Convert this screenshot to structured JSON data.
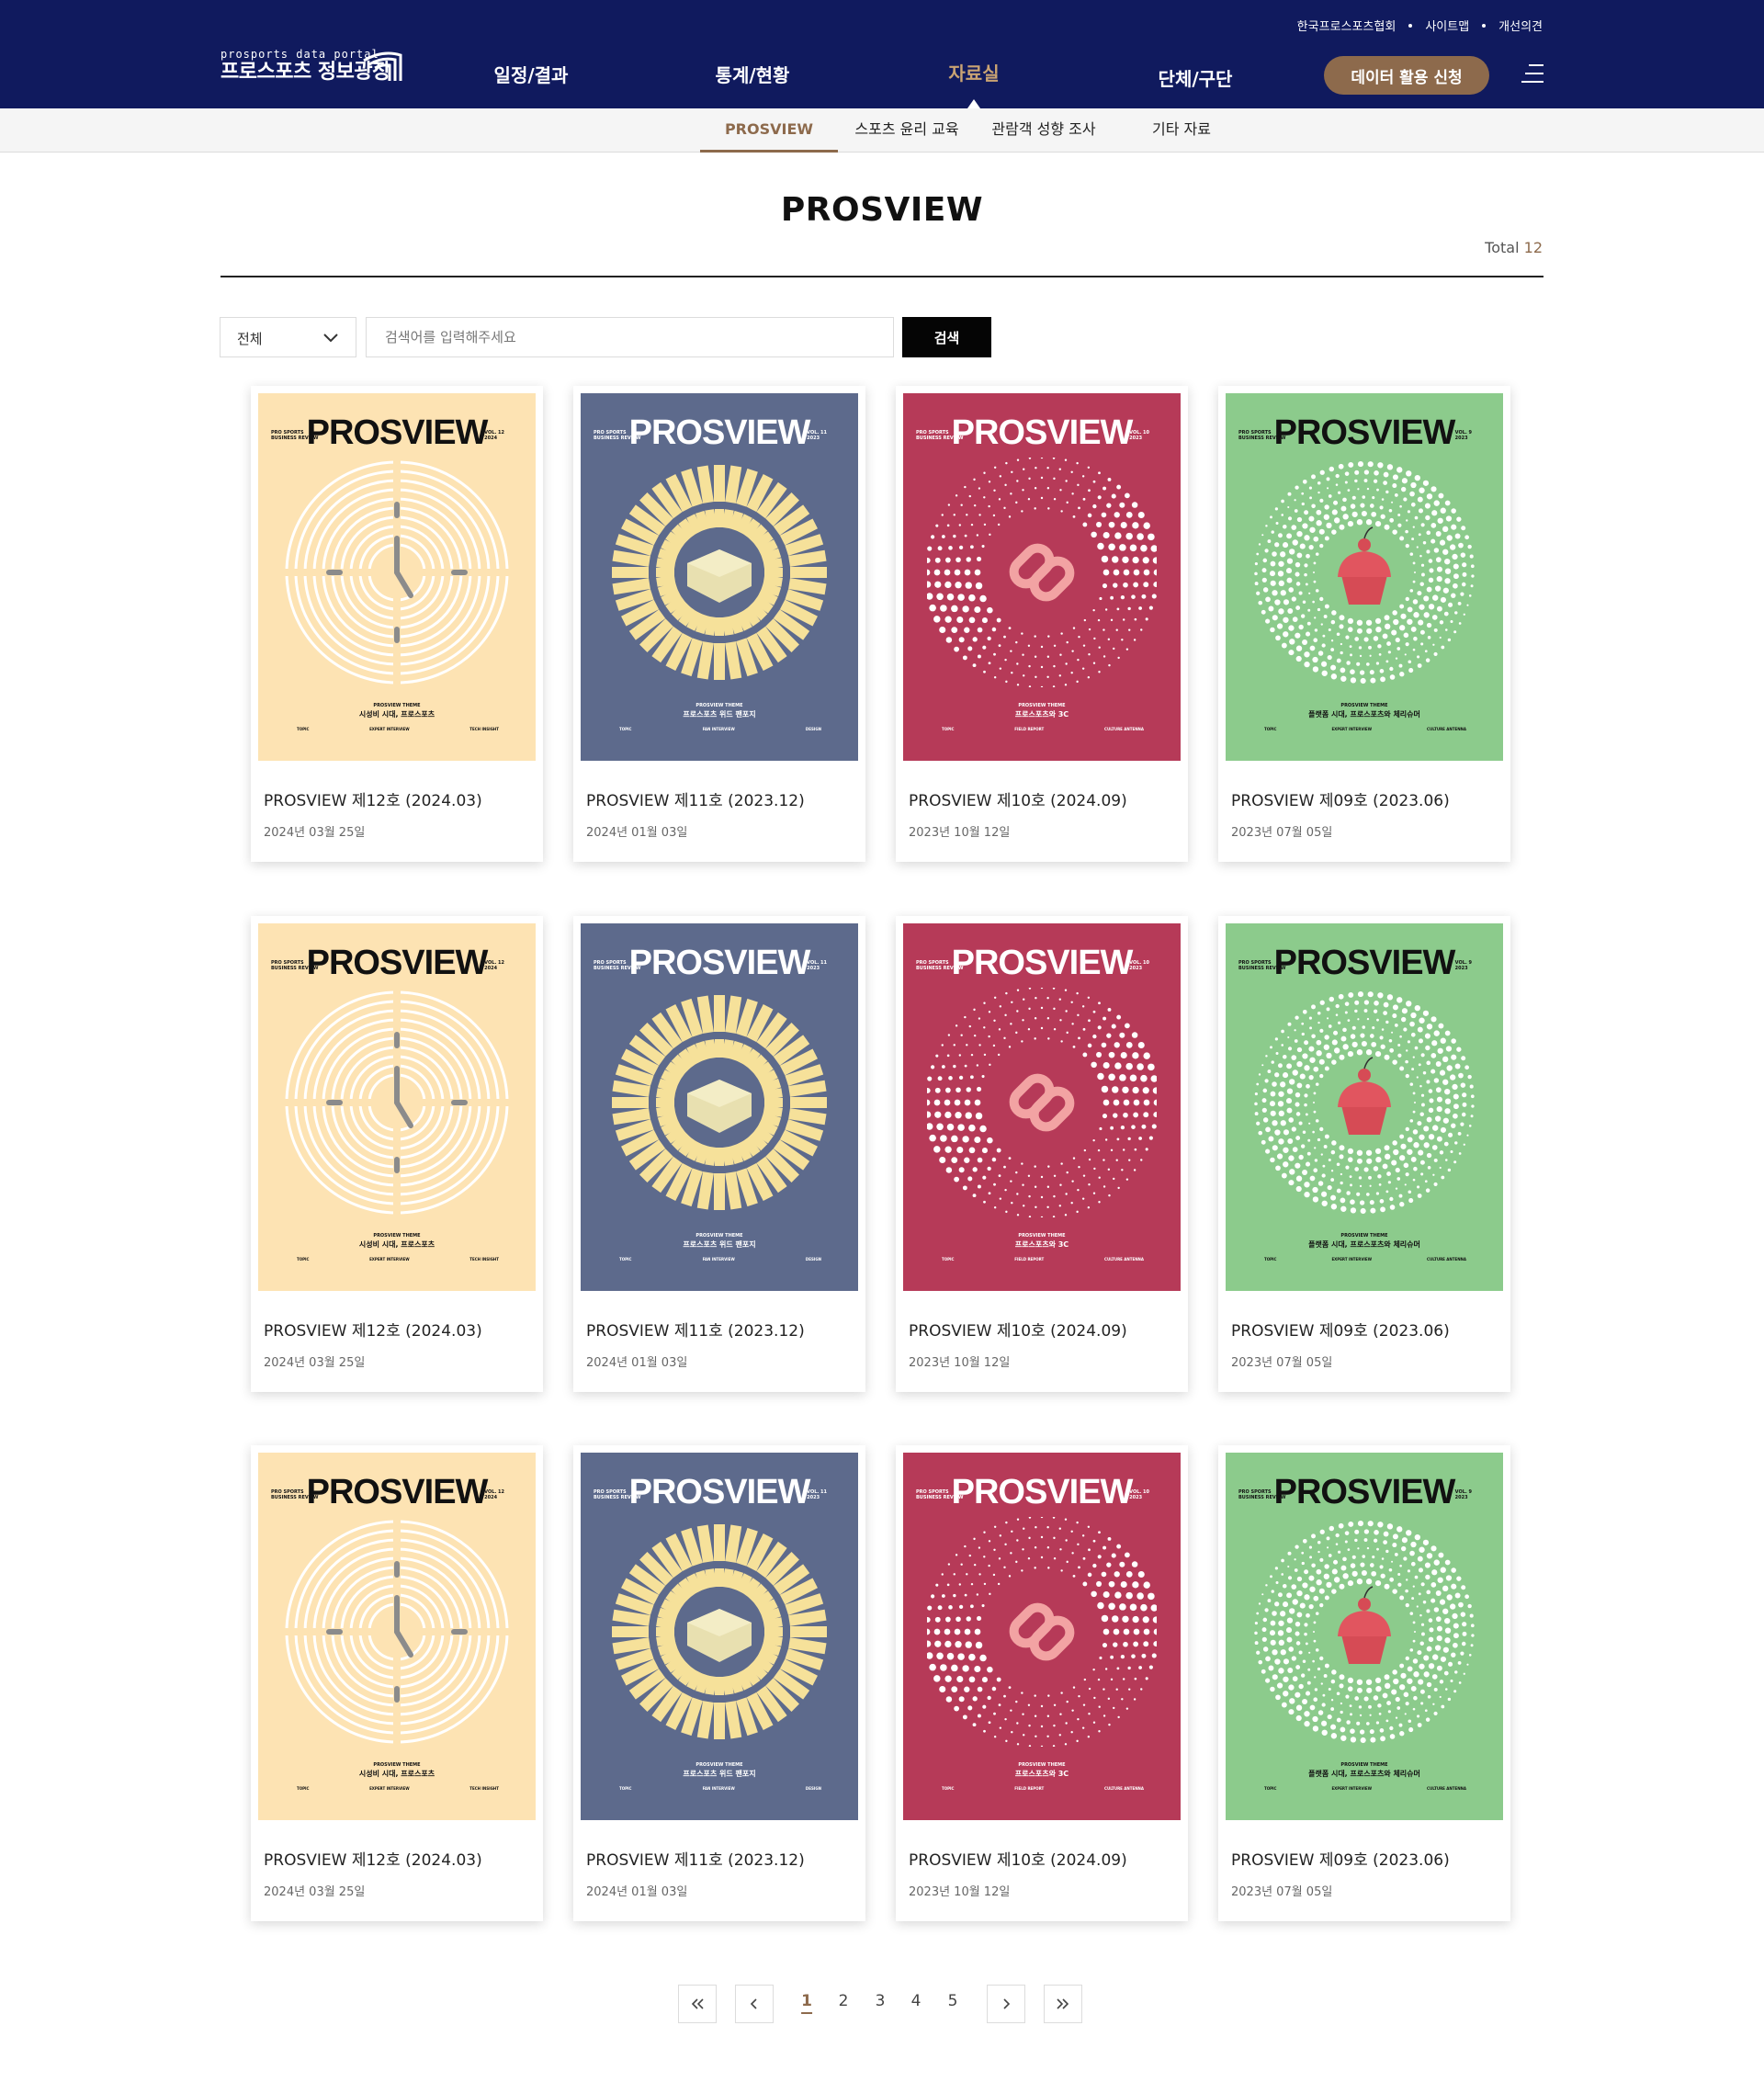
{
  "header": {
    "util_links": [
      "한국프로스포츠협회",
      "사이트맵",
      "개선의견"
    ],
    "logo_small": "prosports data portal",
    "logo_big": "프로스포츠 정보광장",
    "nav": [
      "일정/결과",
      "통계/현황",
      "자료실",
      "단체/구단"
    ],
    "active_nav": "자료실",
    "apply_button": "데이터 활용 신청",
    "menu_icon": "hamburger-menu-icon"
  },
  "subnav": {
    "items": [
      "PROSVIEW",
      "스포츠 윤리 교육",
      "관람객 성향 조사",
      "기타 자료"
    ],
    "active": "PROSVIEW"
  },
  "page": {
    "title": "PROSVIEW",
    "total_label": "Total",
    "total_count": "12"
  },
  "search": {
    "select_value": "전체",
    "placeholder": "검색어를 입력해주세요",
    "button": "검색"
  },
  "cover_text": {
    "brand": "PROSVIEW",
    "pre_line1": "PRO SPORTS",
    "pre_line2": "BUSINESS REVIEW",
    "theme_heading": "PROSVIEW THEME"
  },
  "covers": {
    "vol12": {
      "bg": "#fde3b3",
      "ink": "#111111",
      "vol": "VOL. 12",
      "year": "2024",
      "theme": "시성비 시대, 프로스포츠",
      "cols": [
        "TOPIC",
        "EXPERT INTERVIEW",
        "TECH INSIGHT"
      ],
      "art": "clock-icon"
    },
    "vol11": {
      "bg": "#5d6a8c",
      "ink": "#ffffff",
      "vol": "VOL. 11",
      "year": "2023",
      "theme": "프로스포츠 위드 팬포지",
      "cols": [
        "TOPIC",
        "FAN INTERVIEW",
        "DESIGN"
      ],
      "art": "lego-brick-icon"
    },
    "vol10": {
      "bg": "#b63a58",
      "ink": "#ffffff",
      "vol": "VOL. 10",
      "year": "2023",
      "theme": "프로스포츠와 3C",
      "cols": [
        "TOPIC",
        "FIELD REPORT",
        "CULTURE ANTENNA"
      ],
      "art": "chain-link-icon"
    },
    "vol09": {
      "bg": "#8ccb8c",
      "ink": "#111111",
      "vol": "VOL. 9",
      "year": "2023",
      "theme": "플랫폼 시대, 프로스포츠와 체리슈머",
      "cols": [
        "TOPIC",
        "EXPERT INTERVIEW",
        "CULTURE ANTENNA"
      ],
      "art": "cupcake-icon"
    }
  },
  "items": [
    {
      "cover": "vol12",
      "title": "PROSVIEW 제12호 (2024.03)",
      "date": "2024년 03월 25일"
    },
    {
      "cover": "vol11",
      "title": "PROSVIEW 제11호 (2023.12)",
      "date": "2024년 01월 03일"
    },
    {
      "cover": "vol10",
      "title": "PROSVIEW 제10호 (2024.09)",
      "date": "2023년 10월 12일"
    },
    {
      "cover": "vol09",
      "title": "PROSVIEW 제09호 (2023.06)",
      "date": "2023년 07월 05일"
    },
    {
      "cover": "vol12",
      "title": "PROSVIEW 제12호 (2024.03)",
      "date": "2024년 03월 25일"
    },
    {
      "cover": "vol11",
      "title": "PROSVIEW 제11호 (2023.12)",
      "date": "2024년 01월 03일"
    },
    {
      "cover": "vol10",
      "title": "PROSVIEW 제10호 (2024.09)",
      "date": "2023년 10월 12일"
    },
    {
      "cover": "vol09",
      "title": "PROSVIEW 제09호 (2023.06)",
      "date": "2023년 07월 05일"
    },
    {
      "cover": "vol12",
      "title": "PROSVIEW 제12호 (2024.03)",
      "date": "2024년 03월 25일"
    },
    {
      "cover": "vol11",
      "title": "PROSVIEW 제11호 (2023.12)",
      "date": "2024년 01월 03일"
    },
    {
      "cover": "vol10",
      "title": "PROSVIEW 제10호 (2024.09)",
      "date": "2023년 10월 12일"
    },
    {
      "cover": "vol09",
      "title": "PROSVIEW 제09호 (2023.06)",
      "date": "2023년 07월 05일"
    }
  ],
  "pagination": {
    "pages": [
      "1",
      "2",
      "3",
      "4",
      "5"
    ],
    "current": "1",
    "icons": [
      "first-page-icon",
      "prev-page-icon",
      "next-page-icon",
      "last-page-icon"
    ]
  }
}
